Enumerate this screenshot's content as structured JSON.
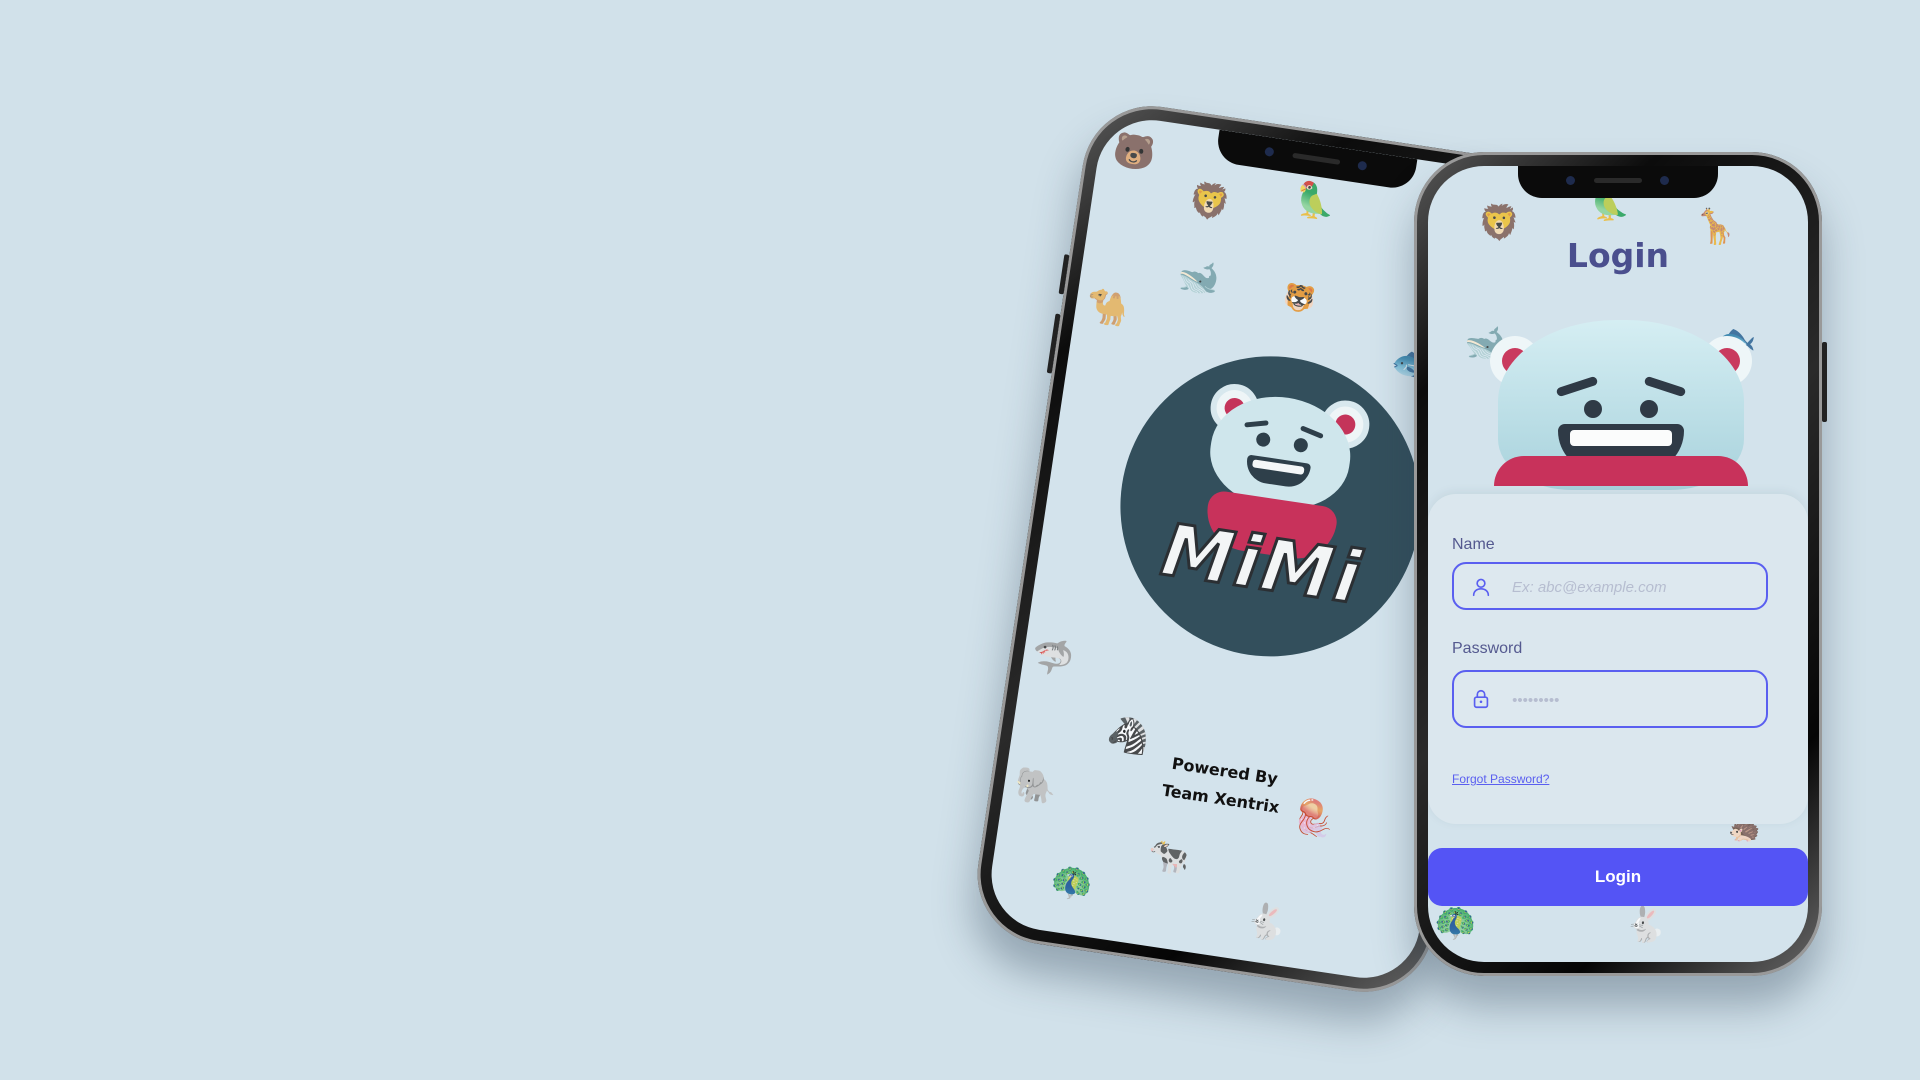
{
  "splash": {
    "logo_text": "MiMi",
    "powered_line1": "Powered By",
    "powered_line2": "Team Xentrix"
  },
  "login": {
    "title": "Login",
    "name_label": "Name",
    "name_placeholder": "Ex: abc@example.com",
    "password_label": "Password",
    "password_placeholder": "•••••••••",
    "forgot_label": "Forgot Password?",
    "submit_label": "Login"
  },
  "icons": {
    "user": "user-icon",
    "lock": "lock-icon"
  },
  "colors": {
    "background": "#d1e1ea",
    "accent": "#5454f5",
    "title": "#4a4f8e",
    "logo_circle": "#334f5c",
    "scarf": "#c8325b"
  }
}
